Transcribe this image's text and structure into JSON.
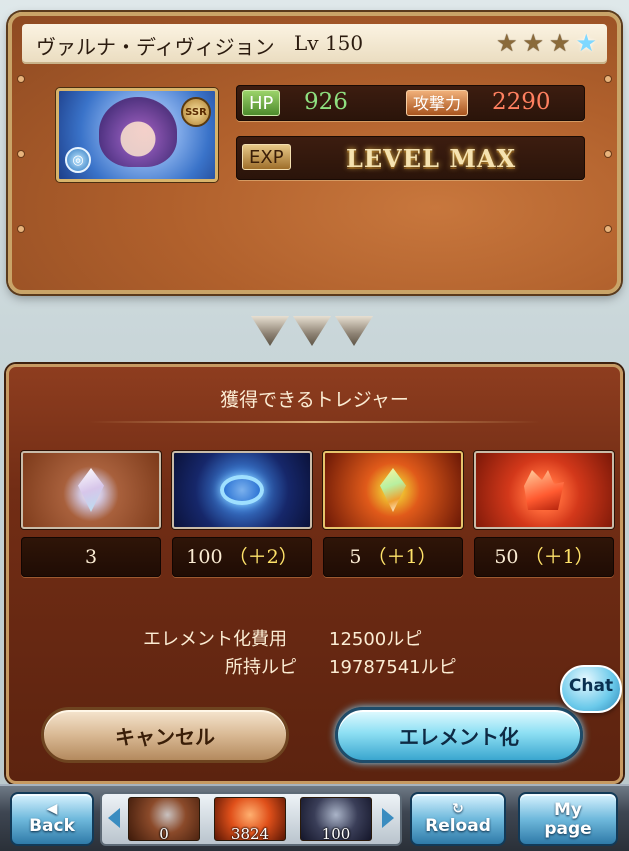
{
  "character": {
    "name": "ヴァルナ・ディヴィジョン",
    "level_label": "Lv",
    "level": "150",
    "rarity_badge": "SSR",
    "stars": [
      {
        "icon": "star-icon",
        "color": "#8a6a3a",
        "glyph": "★"
      },
      {
        "icon": "star-icon",
        "color": "#8a6a3a",
        "glyph": "★"
      },
      {
        "icon": "star-icon",
        "color": "#8a6a3a",
        "glyph": "★"
      },
      {
        "icon": "star-blue-icon",
        "color": "#7fd8ff",
        "glyph": "★"
      }
    ],
    "element_icon": "water-element-icon",
    "hp_label": "HP",
    "hp": "926",
    "atk_label": "攻撃力",
    "atk": "2290",
    "exp_label": "EXP",
    "exp_status": "LEVEL MAX"
  },
  "panel": {
    "title": "獲得できるトレジャー",
    "items": [
      {
        "icon": "quartz-crystal-icon",
        "count": "3",
        "bonus": ""
      },
      {
        "icon": "anima-icon",
        "count": "100",
        "bonus": "（＋2）"
      },
      {
        "icon": "prism-crystal-icon",
        "count": "5",
        "bonus": "（＋1）"
      },
      {
        "icon": "fire-quartz-icon",
        "count": "50",
        "bonus": "（＋1）"
      }
    ],
    "cost_label": "エレメント化費用",
    "cost_value": "12500ルピ",
    "owned_label": "所持ルピ",
    "owned_value": "19787541ルピ",
    "cancel_button": "キャンセル",
    "confirm_button": "エレメント化"
  },
  "chat_button": "Chat",
  "bottom_bar": {
    "back_label": "Back",
    "reload_label": "Reload",
    "mypage_line1": "My",
    "mypage_line2": "page",
    "resources": [
      {
        "icon": "resource-1-icon",
        "value": "0"
      },
      {
        "icon": "resource-2-icon",
        "value": "3824"
      },
      {
        "icon": "resource-3-icon",
        "value": "100"
      }
    ]
  },
  "colors": {
    "hp_value": "#8fe080",
    "atk_value": "#ff8060",
    "bonus": "#ffe36a"
  }
}
